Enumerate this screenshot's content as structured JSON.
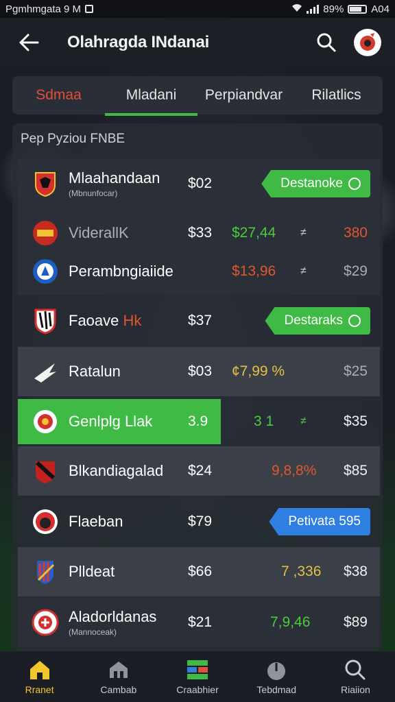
{
  "status_bar": {
    "left_text": "Pgmhmgata 9 M",
    "battery_text": "89%",
    "time": "A04"
  },
  "app_bar": {
    "title": "Olahragda INdanai",
    "back_icon": "back-arrow-icon",
    "search_icon": "search-icon",
    "avatar_icon": "team-avatar-icon"
  },
  "tabs": [
    {
      "label": "Sdmaa",
      "color": "#e2503a"
    },
    {
      "label": "Mladani",
      "active": true
    },
    {
      "label": "Perpiandvar"
    },
    {
      "label": "Rilatlics"
    }
  ],
  "panel": {
    "title": "Pep Pyziou FNBE"
  },
  "rows": [
    {
      "name": "Mlaahandaan",
      "sub": "(Mbnunfocar)",
      "price": "$02",
      "pill": "Destanoke"
    },
    {
      "name": "ViderallK",
      "price": "$33",
      "change": "$27,44",
      "arrow": "≠",
      "last": "380"
    },
    {
      "name": "Perambngiaiide",
      "price": "",
      "change": "$13,96",
      "arrow": "≠",
      "last": "$29"
    },
    {
      "name_part1": "Faoave",
      "name_part2": "Hk",
      "price": "$37",
      "pill": "Destaraks"
    },
    {
      "name": "Ratalun",
      "price": "$03",
      "change": "¢7,99 %",
      "last": "$25"
    },
    {
      "name": "Genlplg Llak",
      "price": "3.9",
      "change": "3 1",
      "arrow": "≠",
      "last": "$35"
    },
    {
      "name": "Blkandiagalad",
      "price": "$24",
      "change": "9,8,8%",
      "last": "$85"
    },
    {
      "name": "Flaeban",
      "price": "$79",
      "pill": "Petivata 595"
    },
    {
      "name": "Plldeat",
      "price": "$66",
      "change": "7 ,336",
      "last": "$38"
    },
    {
      "name": "Aladorldanas",
      "sub": "(Mannoceak)",
      "price": "$21",
      "change": "7,9,46",
      "last": "$89"
    }
  ],
  "bottom_nav": [
    {
      "label": "Rranet",
      "icon": "home-icon",
      "active": true
    },
    {
      "label": "Cambab",
      "icon": "stadium-icon"
    },
    {
      "label": "Craabhier",
      "icon": "chart-icon"
    },
    {
      "label": "Tebdmad",
      "icon": "gauge-icon"
    },
    {
      "label": "Riaiion",
      "icon": "search-icon"
    }
  ],
  "colors": {
    "accent_green": "#3fbb45",
    "accent_blue": "#2f7fe0",
    "accent_red": "#e2503a",
    "accent_yellow": "#f3c72c"
  }
}
